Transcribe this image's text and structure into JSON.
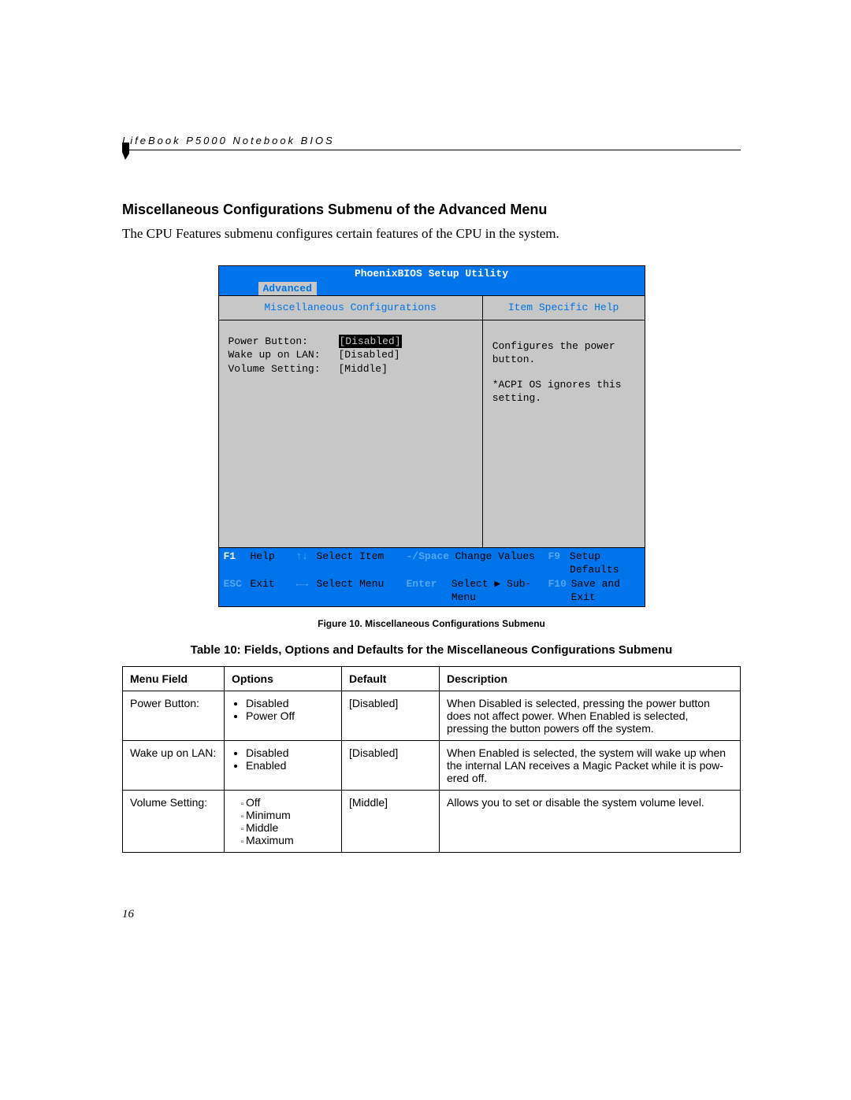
{
  "header": "LifeBook P5000 Notebook BIOS",
  "section_title": "Miscellaneous Configurations Submenu of the Advanced Menu",
  "section_body": "The CPU Features submenu configures certain features of the CPU in the system.",
  "bios": {
    "title": "PhoenixBIOS Setup Utility",
    "active_tab": "Advanced",
    "main_header": "Miscellaneous Configurations",
    "help_header": "Item Specific Help",
    "rows": [
      {
        "label": "Power Button:",
        "value": "[Disabled]",
        "selected": true
      },
      {
        "label": "Wake up on LAN:",
        "value": "[Disabled]",
        "selected": false
      },
      {
        "label": "Volume Setting:",
        "value": "[Middle]",
        "selected": false
      }
    ],
    "help_text_1": "Configures the power button.",
    "help_text_2": "*ACPI OS ignores this setting.",
    "footer": {
      "r1": {
        "k1": "F1",
        "t1": "Help",
        "k2": "↑↓",
        "t2": "Select Item",
        "k3": "-/Space",
        "t3": "Change Values",
        "k4": "F9",
        "t4": "Setup Defaults"
      },
      "r2": {
        "k1": "ESC",
        "t1": "Exit",
        "k2": "←→",
        "t2": "Select Menu",
        "k3": "Enter",
        "t3": "Select ▶ Sub-Menu",
        "k4": "F10",
        "t4": "Save and Exit"
      }
    }
  },
  "figure_caption": "Figure 10.  Miscellaneous Configurations Submenu",
  "table_title": "Table 10: Fields, Options and Defaults for the Miscellaneous Configurations Submenu",
  "table": {
    "headers": {
      "field": "Menu Field",
      "options": "Options",
      "default": "Default",
      "desc": "Description"
    },
    "rows": [
      {
        "field": "Power Button:",
        "options": [
          "Disabled",
          "Power Off"
        ],
        "options_style": "bullet",
        "default": "[Disabled]",
        "desc": "When Disabled is selected, pressing the power button does not affect power. When Enabled is selected, pressing the button powers off the system."
      },
      {
        "field": "Wake up on LAN:",
        "options": [
          "Disabled",
          "Enabled"
        ],
        "options_style": "bullet",
        "default": "[Disabled]",
        "desc": "When Enabled is selected, the system will wake up when the internal LAN receives a Magic Packet while it is pow-ered off."
      },
      {
        "field": "Volume Setting:",
        "options": [
          "Off",
          "Minimum",
          "Middle",
          "Maximum"
        ],
        "options_style": "small",
        "default": "[Middle]",
        "desc": "Allows you to set or disable the system volume level."
      }
    ]
  },
  "page_number": "16"
}
